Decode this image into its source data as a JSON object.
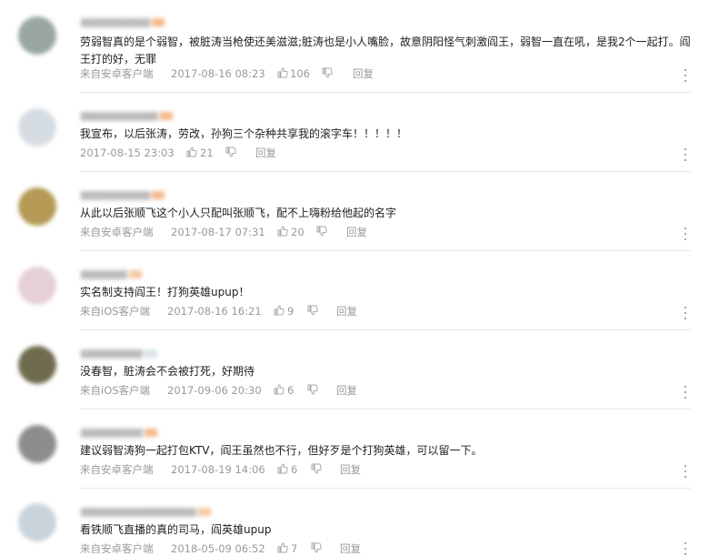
{
  "comments": [
    {
      "text": "劳弱智真的是个弱智，被脏涛当枪使还美滋滋;脏涛也是小人嘴脸，故意阴阳怪气刺激阎王，弱智一直在吼，是我2个一起打。阎王打的好，无罪",
      "source": "来自安卓客户端",
      "time": "2017-08-16 08:23",
      "likes": "106",
      "reply": "回复",
      "avatar_color": "#9aa7a0"
    },
    {
      "text": "我宣布，以后张涛，劳改，孙狗三个杂种共享我的滚字车！！！！！",
      "source": "",
      "time": "2017-08-15 23:03",
      "likes": "21",
      "reply": "回复",
      "avatar_color": "#d6dde2"
    },
    {
      "text": "从此以后张顺飞这个小人只配叫张顺飞，配不上嗨粉给他起的名字",
      "source": "来自安卓客户端",
      "time": "2017-08-17 07:31",
      "likes": "20",
      "reply": "回复",
      "avatar_color": "#b59a55"
    },
    {
      "text": "实名制支持阎王！打狗英雄upup！",
      "source": "来自iOS客户端",
      "time": "2017-08-16 16:21",
      "likes": "9",
      "reply": "回复",
      "avatar_color": "#e6cfd6"
    },
    {
      "text": "没春智，脏涛会不会被打死，好期待",
      "source": "来自iOS客户端",
      "time": "2017-09-06 20:30",
      "likes": "6",
      "reply": "回复",
      "avatar_color": "#6f6c4e"
    },
    {
      "text": "建议弱智涛狗一起打包KTV，阎王虽然也不行，但好歹是个打狗英雄，可以留一下。",
      "source": "来自安卓客户端",
      "time": "2017-08-19 14:06",
      "likes": "6",
      "reply": "回复",
      "avatar_color": "#8d8d8d"
    },
    {
      "text": "看铁顺飞直播的真的司马，阎英雄upup",
      "source": "来自安卓客户端",
      "time": "2018-05-09 06:52",
      "likes": "7",
      "reply": "回复",
      "avatar_color": "#c9d3dc"
    }
  ],
  "icons": {
    "like": "thumbs-up-icon",
    "dislike": "thumbs-down-icon",
    "more": "more-vertical-icon"
  }
}
